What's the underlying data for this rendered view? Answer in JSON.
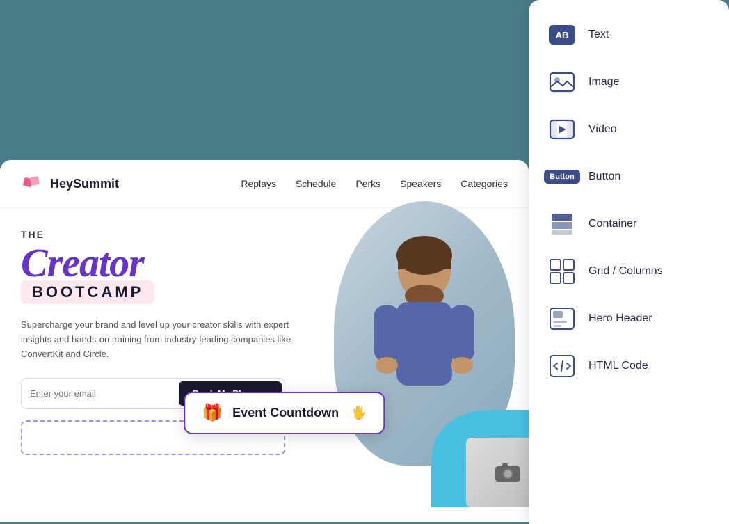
{
  "website": {
    "logo_text": "HeySummit",
    "nav": {
      "links": [
        "Replays",
        "Schedule",
        "Perks",
        "Speakers",
        "Categories"
      ]
    },
    "hero": {
      "title_the": "THE",
      "title_creator": "Creator",
      "title_bootcamp": "BOOTCAMP",
      "description": "Supercharge your brand and level up your creator skills with expert insights and hands-on training from industry-leading companies like ConvertKit and Circle.",
      "email_placeholder": "Enter your email",
      "book_button": "Book My Place →"
    }
  },
  "countdown_widget": {
    "label": "Event Countdown"
  },
  "widget_panel": {
    "items": [
      {
        "id": "text",
        "label": "Text"
      },
      {
        "id": "image",
        "label": "Image"
      },
      {
        "id": "video",
        "label": "Video"
      },
      {
        "id": "button",
        "label": "Button"
      },
      {
        "id": "container",
        "label": "Container"
      },
      {
        "id": "grid-columns",
        "label": "Grid / Columns"
      },
      {
        "id": "hero-header",
        "label": "Hero Header"
      },
      {
        "id": "html-code",
        "label": "HTML Code"
      }
    ]
  }
}
